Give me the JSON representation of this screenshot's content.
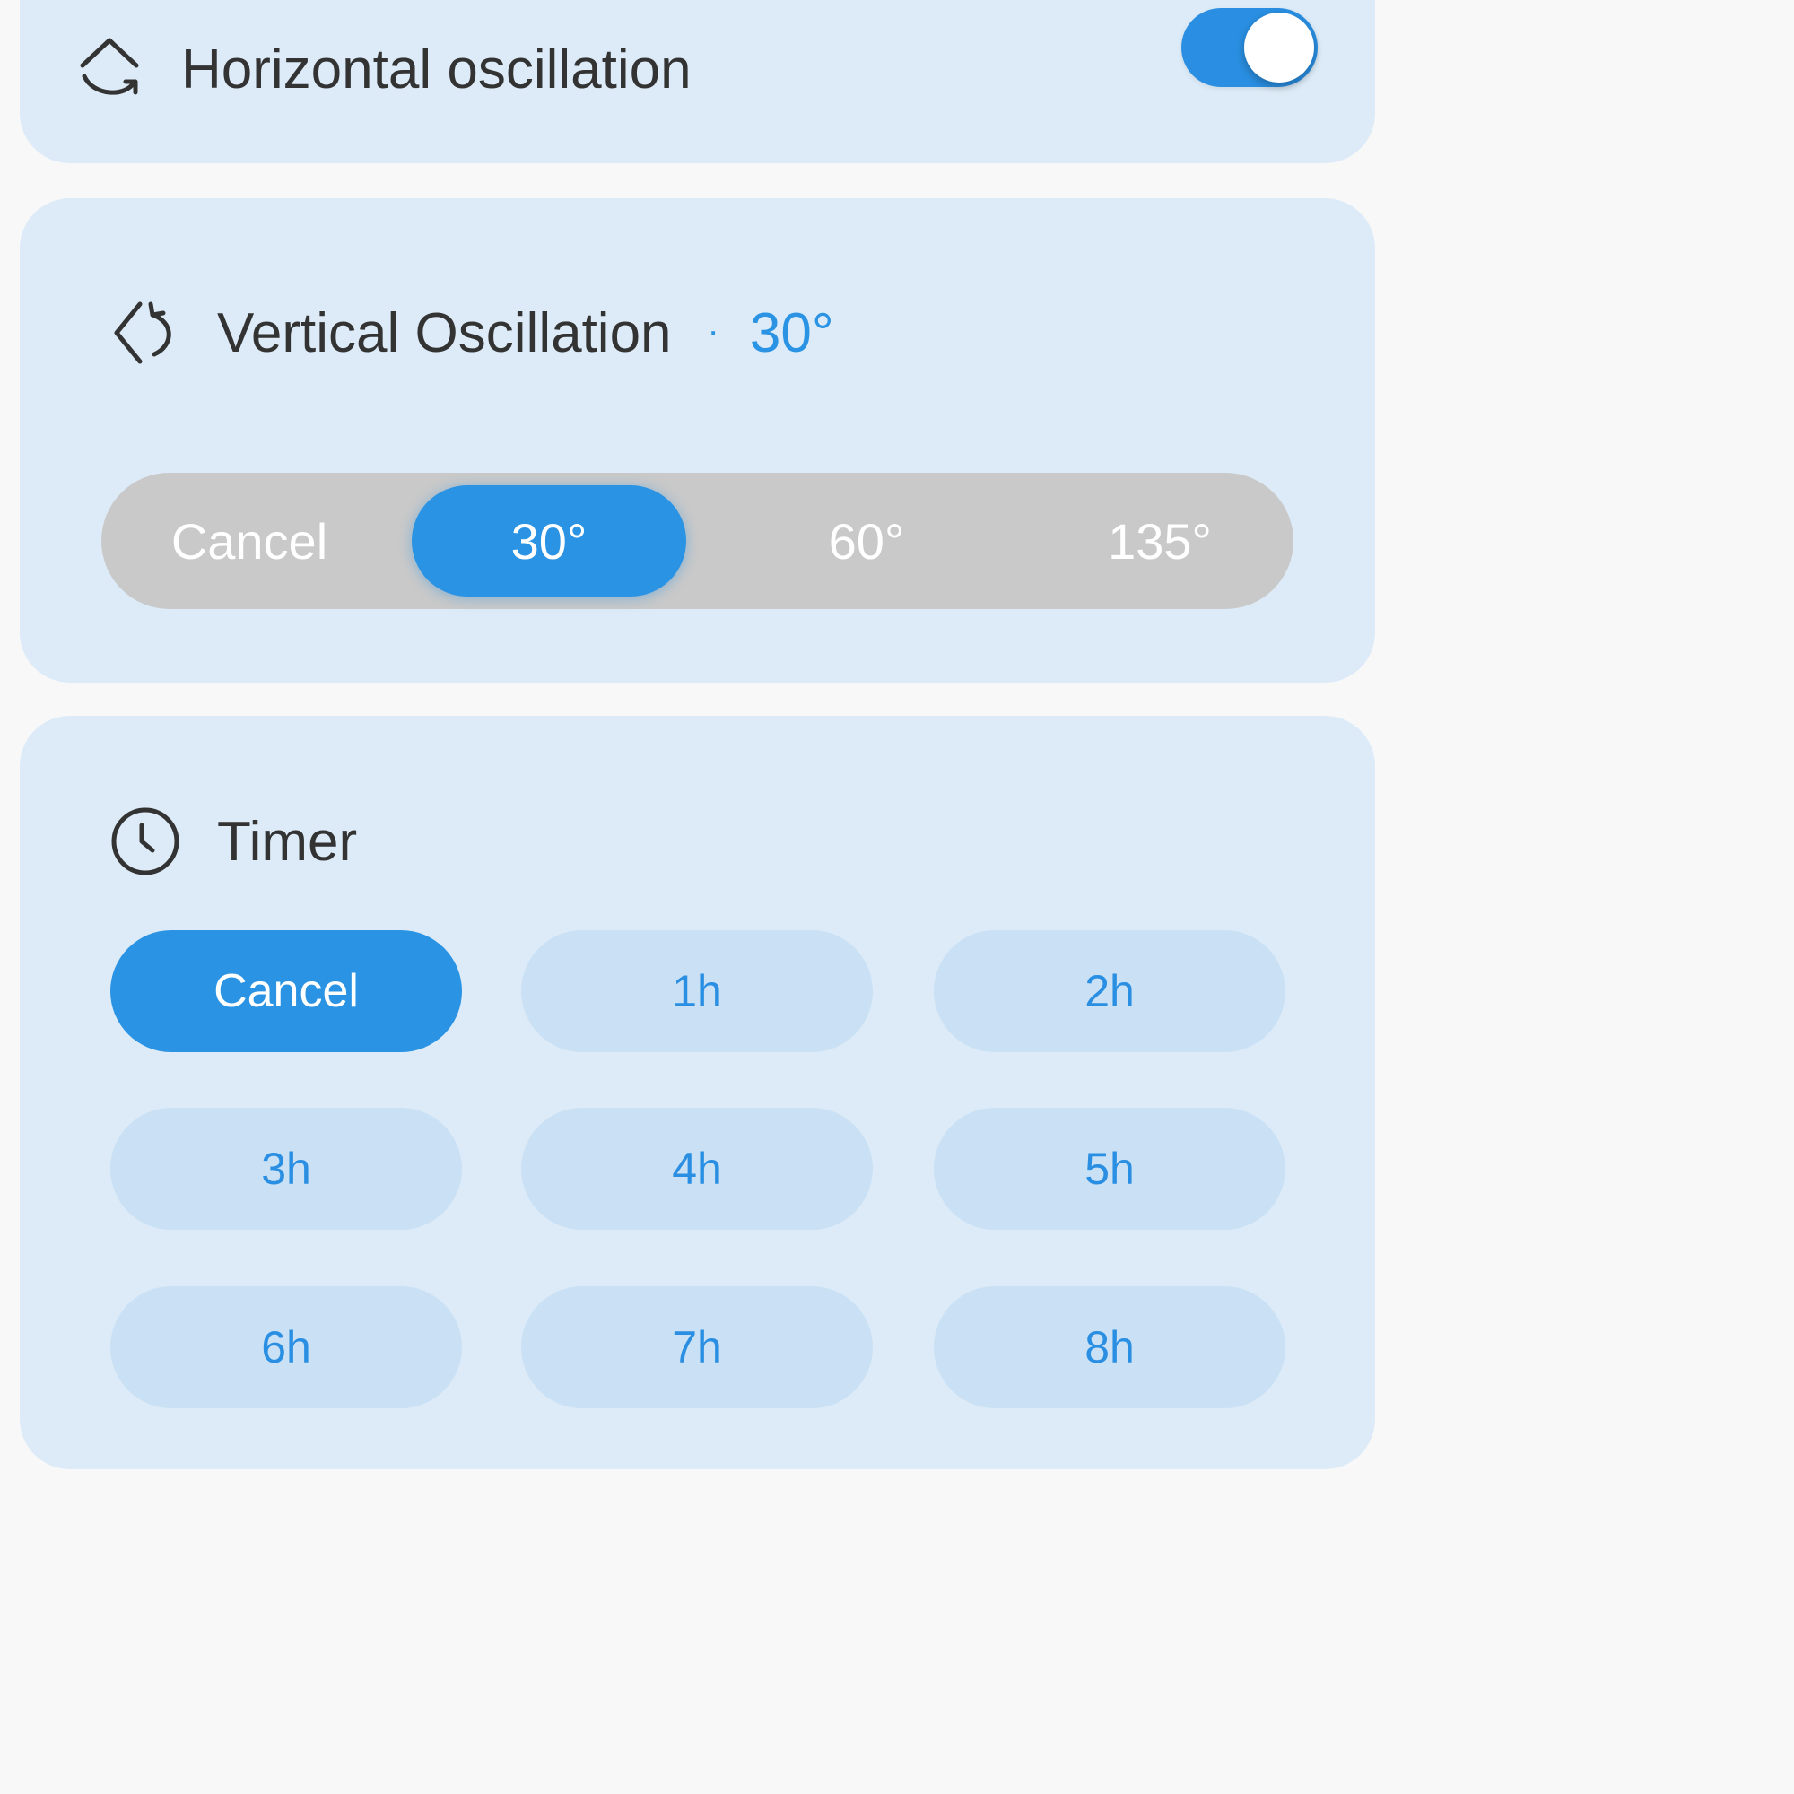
{
  "horizontal": {
    "label": "Horizontal oscillation",
    "icon": "horizontal-rotate-icon",
    "toggle_on": true
  },
  "vertical": {
    "label": "Vertical Oscillation",
    "separator": "·",
    "value": "30°",
    "icon": "vertical-rotate-icon",
    "options": [
      "Cancel",
      "30°",
      "60°",
      "135°"
    ],
    "selected": "30°"
  },
  "timer": {
    "label": "Timer",
    "icon": "clock-icon",
    "options": [
      "Cancel",
      "1h",
      "2h",
      "3h",
      "4h",
      "5h",
      "6h",
      "7h",
      "8h"
    ],
    "selected": "Cancel"
  },
  "colors": {
    "accent": "#2a93e4",
    "card_background": "#dcebf7",
    "segment_background": "#c9c9c9",
    "chip_background": "#cae1f5",
    "text": "#333333"
  }
}
